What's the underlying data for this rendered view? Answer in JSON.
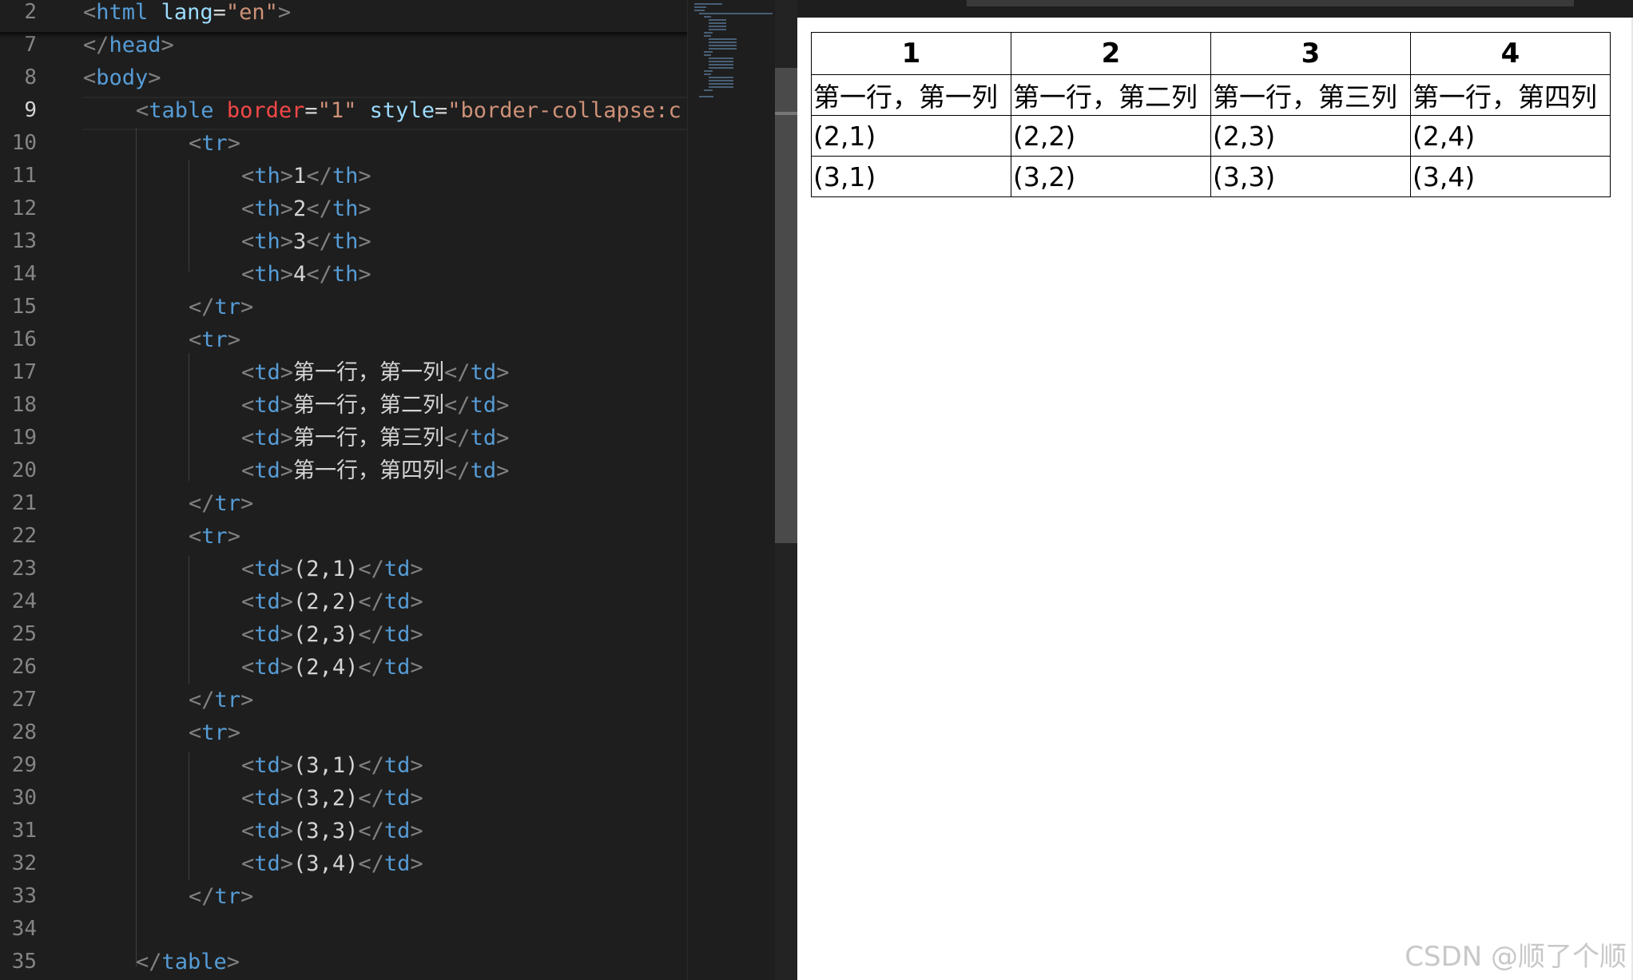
{
  "editor": {
    "lines": [
      {
        "num": "2",
        "indent": 0,
        "tokens": [
          [
            "t",
            "<"
          ],
          [
            "n",
            "html"
          ],
          [
            "x",
            " "
          ],
          [
            "a",
            "lang"
          ],
          [
            "x",
            "="
          ],
          [
            "s",
            "\"en\""
          ],
          [
            "t",
            ">"
          ]
        ]
      },
      {
        "num": "7",
        "indent": 0,
        "tokens": [
          [
            "t",
            "</"
          ],
          [
            "n",
            "head"
          ],
          [
            "t",
            ">"
          ]
        ]
      },
      {
        "num": "8",
        "indent": 0,
        "tokens": [
          [
            "t",
            "<"
          ],
          [
            "n",
            "body"
          ],
          [
            "t",
            ">"
          ]
        ]
      },
      {
        "num": "9",
        "indent": 1,
        "active": true,
        "tokens": [
          [
            "t",
            "<"
          ],
          [
            "n",
            "table"
          ],
          [
            "x",
            " "
          ],
          [
            "ar",
            "border"
          ],
          [
            "x",
            "="
          ],
          [
            "s",
            "\"1\""
          ],
          [
            "x",
            " "
          ],
          [
            "a",
            "style"
          ],
          [
            "x",
            "="
          ],
          [
            "s",
            "\"border-collapse:c"
          ]
        ]
      },
      {
        "num": "10",
        "indent": 2,
        "tokens": [
          [
            "t",
            "<"
          ],
          [
            "n",
            "tr"
          ],
          [
            "t",
            ">"
          ]
        ]
      },
      {
        "num": "11",
        "indent": 3,
        "tokens": [
          [
            "t",
            "<"
          ],
          [
            "n",
            "th"
          ],
          [
            "t",
            ">"
          ],
          [
            "x",
            "1"
          ],
          [
            "t",
            "</"
          ],
          [
            "n",
            "th"
          ],
          [
            "t",
            ">"
          ]
        ]
      },
      {
        "num": "12",
        "indent": 3,
        "tokens": [
          [
            "t",
            "<"
          ],
          [
            "n",
            "th"
          ],
          [
            "t",
            ">"
          ],
          [
            "x",
            "2"
          ],
          [
            "t",
            "</"
          ],
          [
            "n",
            "th"
          ],
          [
            "t",
            ">"
          ]
        ]
      },
      {
        "num": "13",
        "indent": 3,
        "tokens": [
          [
            "t",
            "<"
          ],
          [
            "n",
            "th"
          ],
          [
            "t",
            ">"
          ],
          [
            "x",
            "3"
          ],
          [
            "t",
            "</"
          ],
          [
            "n",
            "th"
          ],
          [
            "t",
            ">"
          ]
        ]
      },
      {
        "num": "14",
        "indent": 3,
        "tokens": [
          [
            "t",
            "<"
          ],
          [
            "n",
            "th"
          ],
          [
            "t",
            ">"
          ],
          [
            "x",
            "4"
          ],
          [
            "t",
            "</"
          ],
          [
            "n",
            "th"
          ],
          [
            "t",
            ">"
          ]
        ]
      },
      {
        "num": "15",
        "indent": 2,
        "tokens": [
          [
            "t",
            "</"
          ],
          [
            "n",
            "tr"
          ],
          [
            "t",
            ">"
          ]
        ]
      },
      {
        "num": "16",
        "indent": 2,
        "tokens": [
          [
            "t",
            "<"
          ],
          [
            "n",
            "tr"
          ],
          [
            "t",
            ">"
          ]
        ]
      },
      {
        "num": "17",
        "indent": 3,
        "tokens": [
          [
            "t",
            "<"
          ],
          [
            "n",
            "td"
          ],
          [
            "t",
            ">"
          ],
          [
            "x",
            "第一行，第一列"
          ],
          [
            "t",
            "</"
          ],
          [
            "n",
            "td"
          ],
          [
            "t",
            ">"
          ]
        ]
      },
      {
        "num": "18",
        "indent": 3,
        "tokens": [
          [
            "t",
            "<"
          ],
          [
            "n",
            "td"
          ],
          [
            "t",
            ">"
          ],
          [
            "x",
            "第一行，第二列"
          ],
          [
            "t",
            "</"
          ],
          [
            "n",
            "td"
          ],
          [
            "t",
            ">"
          ]
        ]
      },
      {
        "num": "19",
        "indent": 3,
        "tokens": [
          [
            "t",
            "<"
          ],
          [
            "n",
            "td"
          ],
          [
            "t",
            ">"
          ],
          [
            "x",
            "第一行，第三列"
          ],
          [
            "t",
            "</"
          ],
          [
            "n",
            "td"
          ],
          [
            "t",
            ">"
          ]
        ]
      },
      {
        "num": "20",
        "indent": 3,
        "tokens": [
          [
            "t",
            "<"
          ],
          [
            "n",
            "td"
          ],
          [
            "t",
            ">"
          ],
          [
            "x",
            "第一行，第四列"
          ],
          [
            "t",
            "</"
          ],
          [
            "n",
            "td"
          ],
          [
            "t",
            ">"
          ]
        ]
      },
      {
        "num": "21",
        "indent": 2,
        "tokens": [
          [
            "t",
            "</"
          ],
          [
            "n",
            "tr"
          ],
          [
            "t",
            ">"
          ]
        ]
      },
      {
        "num": "22",
        "indent": 2,
        "tokens": [
          [
            "t",
            "<"
          ],
          [
            "n",
            "tr"
          ],
          [
            "t",
            ">"
          ]
        ]
      },
      {
        "num": "23",
        "indent": 3,
        "tokens": [
          [
            "t",
            "<"
          ],
          [
            "n",
            "td"
          ],
          [
            "t",
            ">"
          ],
          [
            "x",
            "(2,1)"
          ],
          [
            "t",
            "</"
          ],
          [
            "n",
            "td"
          ],
          [
            "t",
            ">"
          ]
        ]
      },
      {
        "num": "24",
        "indent": 3,
        "tokens": [
          [
            "t",
            "<"
          ],
          [
            "n",
            "td"
          ],
          [
            "t",
            ">"
          ],
          [
            "x",
            "(2,2)"
          ],
          [
            "t",
            "</"
          ],
          [
            "n",
            "td"
          ],
          [
            "t",
            ">"
          ]
        ]
      },
      {
        "num": "25",
        "indent": 3,
        "tokens": [
          [
            "t",
            "<"
          ],
          [
            "n",
            "td"
          ],
          [
            "t",
            ">"
          ],
          [
            "x",
            "(2,3)"
          ],
          [
            "t",
            "</"
          ],
          [
            "n",
            "td"
          ],
          [
            "t",
            ">"
          ]
        ]
      },
      {
        "num": "26",
        "indent": 3,
        "tokens": [
          [
            "t",
            "<"
          ],
          [
            "n",
            "td"
          ],
          [
            "t",
            ">"
          ],
          [
            "x",
            "(2,4)"
          ],
          [
            "t",
            "</"
          ],
          [
            "n",
            "td"
          ],
          [
            "t",
            ">"
          ]
        ]
      },
      {
        "num": "27",
        "indent": 2,
        "tokens": [
          [
            "t",
            "</"
          ],
          [
            "n",
            "tr"
          ],
          [
            "t",
            ">"
          ]
        ]
      },
      {
        "num": "28",
        "indent": 2,
        "tokens": [
          [
            "t",
            "<"
          ],
          [
            "n",
            "tr"
          ],
          [
            "t",
            ">"
          ]
        ]
      },
      {
        "num": "29",
        "indent": 3,
        "tokens": [
          [
            "t",
            "<"
          ],
          [
            "n",
            "td"
          ],
          [
            "t",
            ">"
          ],
          [
            "x",
            "(3,1)"
          ],
          [
            "t",
            "</"
          ],
          [
            "n",
            "td"
          ],
          [
            "t",
            ">"
          ]
        ]
      },
      {
        "num": "30",
        "indent": 3,
        "tokens": [
          [
            "t",
            "<"
          ],
          [
            "n",
            "td"
          ],
          [
            "t",
            ">"
          ],
          [
            "x",
            "(3,2)"
          ],
          [
            "t",
            "</"
          ],
          [
            "n",
            "td"
          ],
          [
            "t",
            ">"
          ]
        ]
      },
      {
        "num": "31",
        "indent": 3,
        "tokens": [
          [
            "t",
            "<"
          ],
          [
            "n",
            "td"
          ],
          [
            "t",
            ">"
          ],
          [
            "x",
            "(3,3)"
          ],
          [
            "t",
            "</"
          ],
          [
            "n",
            "td"
          ],
          [
            "t",
            ">"
          ]
        ]
      },
      {
        "num": "32",
        "indent": 3,
        "tokens": [
          [
            "t",
            "<"
          ],
          [
            "n",
            "td"
          ],
          [
            "t",
            ">"
          ],
          [
            "x",
            "(3,4)"
          ],
          [
            "t",
            "</"
          ],
          [
            "n",
            "td"
          ],
          [
            "t",
            ">"
          ]
        ]
      },
      {
        "num": "33",
        "indent": 2,
        "tokens": [
          [
            "t",
            "</"
          ],
          [
            "n",
            "tr"
          ],
          [
            "t",
            ">"
          ]
        ]
      },
      {
        "num": "34",
        "indent": 0,
        "tokens": []
      },
      {
        "num": "35",
        "indent": 1,
        "tokens": [
          [
            "t",
            "</"
          ],
          [
            "n",
            "table"
          ],
          [
            "t",
            ">"
          ]
        ]
      }
    ]
  },
  "preview": {
    "headers": [
      "1",
      "2",
      "3",
      "4"
    ],
    "rows": [
      [
        "第一行，第一列",
        "第一行，第二列",
        "第一行，第三列",
        "第一行，第四列"
      ],
      [
        "(2,1)",
        "(2,2)",
        "(2,3)",
        "(2,4)"
      ],
      [
        "(3,1)",
        "(3,2)",
        "(3,3)",
        "(3,4)"
      ]
    ]
  },
  "watermark": "CSDN @顺了个顺"
}
